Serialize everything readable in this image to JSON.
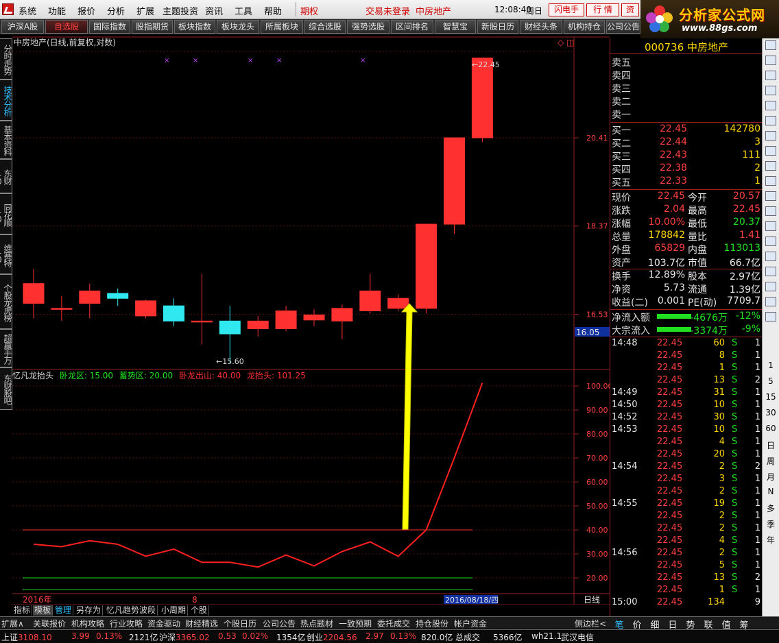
{
  "menu": {
    "items": [
      "系统",
      "功能",
      "报价",
      "分析",
      "扩展",
      "主题投资",
      "资讯",
      "工具",
      "帮助"
    ],
    "trade_right": "期权",
    "login_status": "交易未登录",
    "stock_name": "中房地产",
    "clock": "12:08:40",
    "weekday": "周日",
    "buttons": [
      "闪电手",
      "行  情",
      "资"
    ]
  },
  "brand": {
    "name": "分析家公式网",
    "url": "www.88gs.com"
  },
  "tabs": [
    "沪深A股",
    "自选股",
    "国际指数",
    "股指期货",
    "板块指数",
    "板块龙头",
    "所属板块",
    "综合选股",
    "强势选股",
    "区间排名",
    "智慧宝",
    "新股日历",
    "财经头条",
    "机构持仓",
    "公司公告"
  ],
  "active_tab": "自选股",
  "left_tabs": [
    "分时走势",
    "技术分析",
    "基本资料",
    "东财10",
    "同花顺10",
    "维赛特10",
    "个股龙虎榜",
    "超赢手万",
    "东财股吧"
  ],
  "chart": {
    "title": "中房地产(日线,前复权,对数)",
    "price_ticks": [
      "20.41",
      "18.37",
      "16.53"
    ],
    "current_price_box": "16.05",
    "high_label": "22.45",
    "low_label": "15.60",
    "indicator": {
      "name": "忆凡龙抬头",
      "params": [
        {
          "label": "卧龙区: 15.00",
          "color": "#20e020"
        },
        {
          "label": "蓄势区: 20.00",
          "color": "#20e020"
        },
        {
          "label": "卧龙出山: 40.00",
          "color": "#ff3030"
        },
        {
          "label": "龙抬头: 101.25",
          "color": "#ff3030"
        }
      ],
      "ticks": [
        "100.00",
        "90.00",
        "80.00",
        "70.00",
        "60.00",
        "50.00",
        "40.00",
        "30.00",
        "20.00"
      ]
    },
    "x_label_year": "2016年",
    "x_label_month": "8",
    "date_box": "2016/08/18/四",
    "period": "日线",
    "zoom_controls": [
      "+",
      "-",
      "0"
    ]
  },
  "chart_data": {
    "type": "candlestick",
    "title": "中房地产(日线,前复权,对数)",
    "candles": [
      {
        "open": 16.75,
        "close": 17.15,
        "high": 17.45,
        "low": 16.45
      },
      {
        "open": 16.65,
        "close": 16.65,
        "high": 16.9,
        "low": 16.4
      },
      {
        "open": 16.75,
        "close": 17.0,
        "high": 17.15,
        "low": 16.45
      },
      {
        "open": 16.95,
        "close": 16.85,
        "high": 17.05,
        "low": 16.7
      },
      {
        "open": 16.5,
        "close": 16.8,
        "high": 16.82,
        "low": 16.45
      },
      {
        "open": 16.7,
        "close": 16.4,
        "high": 16.85,
        "low": 16.3
      },
      {
        "open": 16.4,
        "close": 16.4,
        "high": 17.35,
        "low": 15.95
      },
      {
        "open": 16.4,
        "close": 16.15,
        "high": 16.7,
        "low": 15.6
      },
      {
        "open": 16.25,
        "close": 16.4,
        "high": 16.5,
        "low": 16.1
      },
      {
        "open": 16.25,
        "close": 16.6,
        "high": 16.7,
        "low": 16.2
      },
      {
        "open": 16.42,
        "close": 16.52,
        "high": 16.63,
        "low": 16.3
      },
      {
        "open": 16.4,
        "close": 16.65,
        "high": 16.72,
        "low": 16.05
      },
      {
        "open": 16.6,
        "close": 17.0,
        "high": 17.35,
        "low": 16.55
      },
      {
        "open": 16.65,
        "close": 16.85,
        "high": 16.93,
        "low": 16.6
      },
      {
        "open": 16.65,
        "close": 18.41,
        "high": 18.41,
        "low": 16.55
      },
      {
        "open": 18.41,
        "close": 20.41,
        "high": 20.41,
        "low": 18.2
      },
      {
        "open": 20.41,
        "close": 22.45,
        "high": 22.45,
        "low": 20.3
      }
    ],
    "indicator_values": [
      34,
      33,
      35.5,
      34,
      29,
      32,
      26.5,
      26.5,
      24.5,
      29.5,
      25,
      31,
      35,
      29,
      40,
      70,
      101.25
    ],
    "reference_lines": [
      40,
      20,
      15
    ],
    "xlabel": "",
    "ylabel": ""
  },
  "quote": {
    "code": "000736",
    "name": "中房地产",
    "sell": [
      {
        "label": "卖五"
      },
      {
        "label": "卖四"
      },
      {
        "label": "卖三"
      },
      {
        "label": "卖二"
      },
      {
        "label": "卖一"
      }
    ],
    "buy": [
      {
        "label": "买一",
        "price": "22.45",
        "vol": "142780"
      },
      {
        "label": "买二",
        "price": "22.44",
        "vol": "3"
      },
      {
        "label": "买三",
        "price": "22.43",
        "vol": "111"
      },
      {
        "label": "买四",
        "price": "22.38",
        "vol": "2"
      },
      {
        "label": "买五",
        "price": "22.33",
        "vol": "1"
      }
    ],
    "stats1": [
      {
        "l1": "现价",
        "v1": "22.45",
        "c1": "red",
        "l2": "今开",
        "v2": "20.57",
        "c2": "red"
      },
      {
        "l1": "涨跌",
        "v1": "2.04",
        "c1": "red",
        "l2": "最高",
        "v2": "22.45",
        "c2": "red"
      },
      {
        "l1": "涨幅",
        "v1": "10.00%",
        "c1": "red",
        "l2": "最低",
        "v2": "20.37",
        "c2": "green"
      },
      {
        "l1": "总量",
        "v1": "178842",
        "c1": "yellow",
        "l2": "量比",
        "v2": "1.41",
        "c2": "red"
      },
      {
        "l1": "外盘",
        "v1": "65829",
        "c1": "red",
        "l2": "内盘",
        "v2": "113013",
        "c2": "green"
      },
      {
        "l1": "资产",
        "v1": "103.7亿",
        "c1": "white",
        "l2": "市值",
        "v2": "66.7亿",
        "c2": "white"
      }
    ],
    "stats2": [
      {
        "l1": "换手",
        "v1": "12.89%",
        "l2": "股本",
        "v2": "2.97亿"
      },
      {
        "l1": "净资",
        "v1": "5.73",
        "l2": "流通",
        "v2": "1.39亿"
      },
      {
        "l1": "收益(二)",
        "v1": "0.001",
        "l2": "PE(动)",
        "v2": "7709.7"
      }
    ],
    "flows": [
      {
        "label": "净流入额",
        "value": "-4676万",
        "pct": "-12%"
      },
      {
        "label": "大宗流入",
        "value": "-3374万",
        "pct": "-9%"
      }
    ],
    "ticks": [
      {
        "time": "14:48",
        "price": "22.45",
        "vol": "60",
        "side": "S",
        "n": "1"
      },
      {
        "time": "",
        "price": "22.45",
        "vol": "8",
        "side": "S",
        "n": "1"
      },
      {
        "time": "",
        "price": "22.45",
        "vol": "1",
        "side": "S",
        "n": "1"
      },
      {
        "time": "",
        "price": "22.45",
        "vol": "13",
        "side": "S",
        "n": "2"
      },
      {
        "time": "14:49",
        "price": "22.45",
        "vol": "31",
        "side": "S",
        "n": "1"
      },
      {
        "time": "14:50",
        "price": "22.45",
        "vol": "10",
        "side": "S",
        "n": "1"
      },
      {
        "time": "14:52",
        "price": "22.45",
        "vol": "30",
        "side": "S",
        "n": "1"
      },
      {
        "time": "14:53",
        "price": "22.45",
        "vol": "10",
        "side": "S",
        "n": "1"
      },
      {
        "time": "",
        "price": "22.45",
        "vol": "4",
        "side": "S",
        "n": "1"
      },
      {
        "time": "",
        "price": "22.45",
        "vol": "20",
        "side": "S",
        "n": "1"
      },
      {
        "time": "14:54",
        "price": "22.45",
        "vol": "2",
        "side": "S",
        "n": "2"
      },
      {
        "time": "",
        "price": "22.45",
        "vol": "3",
        "side": "S",
        "n": "1"
      },
      {
        "time": "",
        "price": "22.45",
        "vol": "2",
        "side": "S",
        "n": "1"
      },
      {
        "time": "14:55",
        "price": "22.45",
        "vol": "19",
        "side": "S",
        "n": "1"
      },
      {
        "time": "",
        "price": "22.45",
        "vol": "2",
        "side": "S",
        "n": "1"
      },
      {
        "time": "",
        "price": "22.45",
        "vol": "2",
        "side": "S",
        "n": "1"
      },
      {
        "time": "",
        "price": "22.45",
        "vol": "4",
        "side": "S",
        "n": "1"
      },
      {
        "time": "14:56",
        "price": "22.45",
        "vol": "2",
        "side": "S",
        "n": "1"
      },
      {
        "time": "",
        "price": "22.45",
        "vol": "5",
        "side": "S",
        "n": "1"
      },
      {
        "time": "",
        "price": "22.45",
        "vol": "13",
        "side": "S",
        "n": "2"
      },
      {
        "time": "",
        "price": "22.45",
        "vol": "1",
        "side": "S",
        "n": "1"
      },
      {
        "time": "15:00",
        "price": "22.45",
        "vol": "134",
        "side": "",
        "n": "9"
      }
    ]
  },
  "right_toolbar_labels": [
    "1",
    "5",
    "15",
    "30",
    "60",
    "日",
    "周",
    "月",
    "N",
    "多",
    "季",
    "年"
  ],
  "template_bar": [
    "指标",
    "模板",
    "管理",
    "另存为",
    "忆凡趋势波段",
    "小周期",
    "个股"
  ],
  "function_bar": [
    "扩展∧",
    "关联报价",
    "机构攻略",
    "行业攻略",
    "资金驱动",
    "财经精选",
    "个股日历",
    "公司公告",
    "热点题材",
    "一致预期",
    "委托成交",
    "持仓股份",
    "帐户资金"
  ],
  "sidebar_toggle": "侧边栏<",
  "quote_tabs": [
    "笔",
    "价",
    "细",
    "日",
    "势",
    "联",
    "值",
    "筹"
  ],
  "status": {
    "sh_label": "上证",
    "sh_value": "3108.10",
    "sh_chg": "3.99",
    "sh_pct": "0.13%",
    "sh_amt": "2121亿",
    "sz_label": "沪深",
    "sz_value": "3365.02",
    "sz_chg": "0.53",
    "sz_pct": "0.02%",
    "sz_amt": "1354亿",
    "cy_label": "创业",
    "cy_value": "2204.56",
    "cy_chg": "2.97",
    "cy_pct": "0.13%",
    "cy_amt": "820.0亿",
    "total_label": "总成交",
    "total_amt": "5366亿",
    "server": "wh21.1",
    "isp": "武汉电信"
  }
}
